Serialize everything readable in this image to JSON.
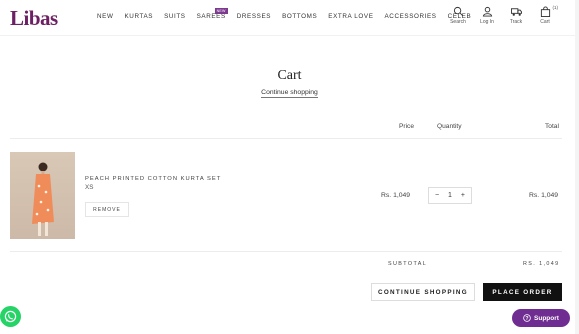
{
  "header": {
    "logo": "Libas",
    "nav": [
      "NEW",
      "KURTAS",
      "SUITS",
      "SAREES",
      "DRESSES",
      "BOTTOMS",
      "EXTRA LOVE",
      "ACCESSORIES",
      "CELEB"
    ],
    "new_badge": "NEW",
    "icons": [
      {
        "label": "Search",
        "icon": "search-icon"
      },
      {
        "label": "Log In",
        "icon": "user-icon"
      },
      {
        "label": "Track",
        "icon": "truck-icon"
      },
      {
        "label": "Cart",
        "icon": "bag-icon"
      }
    ],
    "cart_count": "(1)"
  },
  "page": {
    "title": "Cart",
    "continue_link": "Continue shopping"
  },
  "table": {
    "col_price": "Price",
    "col_quantity": "Quantity",
    "col_total": "Total"
  },
  "item": {
    "name": "PEACH PRINTED COTTON KURTA SET",
    "size": "XS",
    "remove": "REMOVE",
    "price": "Rs. 1,049",
    "qty": "1",
    "minus": "−",
    "plus": "+",
    "total": "Rs. 1,049"
  },
  "summary": {
    "subtotal_label": "SUBTOTAL",
    "subtotal_value": "RS. 1,049",
    "continue_btn": "CONTINUE SHOPPING",
    "place_order_btn": "PLACE ORDER"
  },
  "support": {
    "label": "Support"
  },
  "colors": {
    "brand": "#6d1f63",
    "support": "#6f2c91",
    "whatsapp": "#25d366"
  }
}
